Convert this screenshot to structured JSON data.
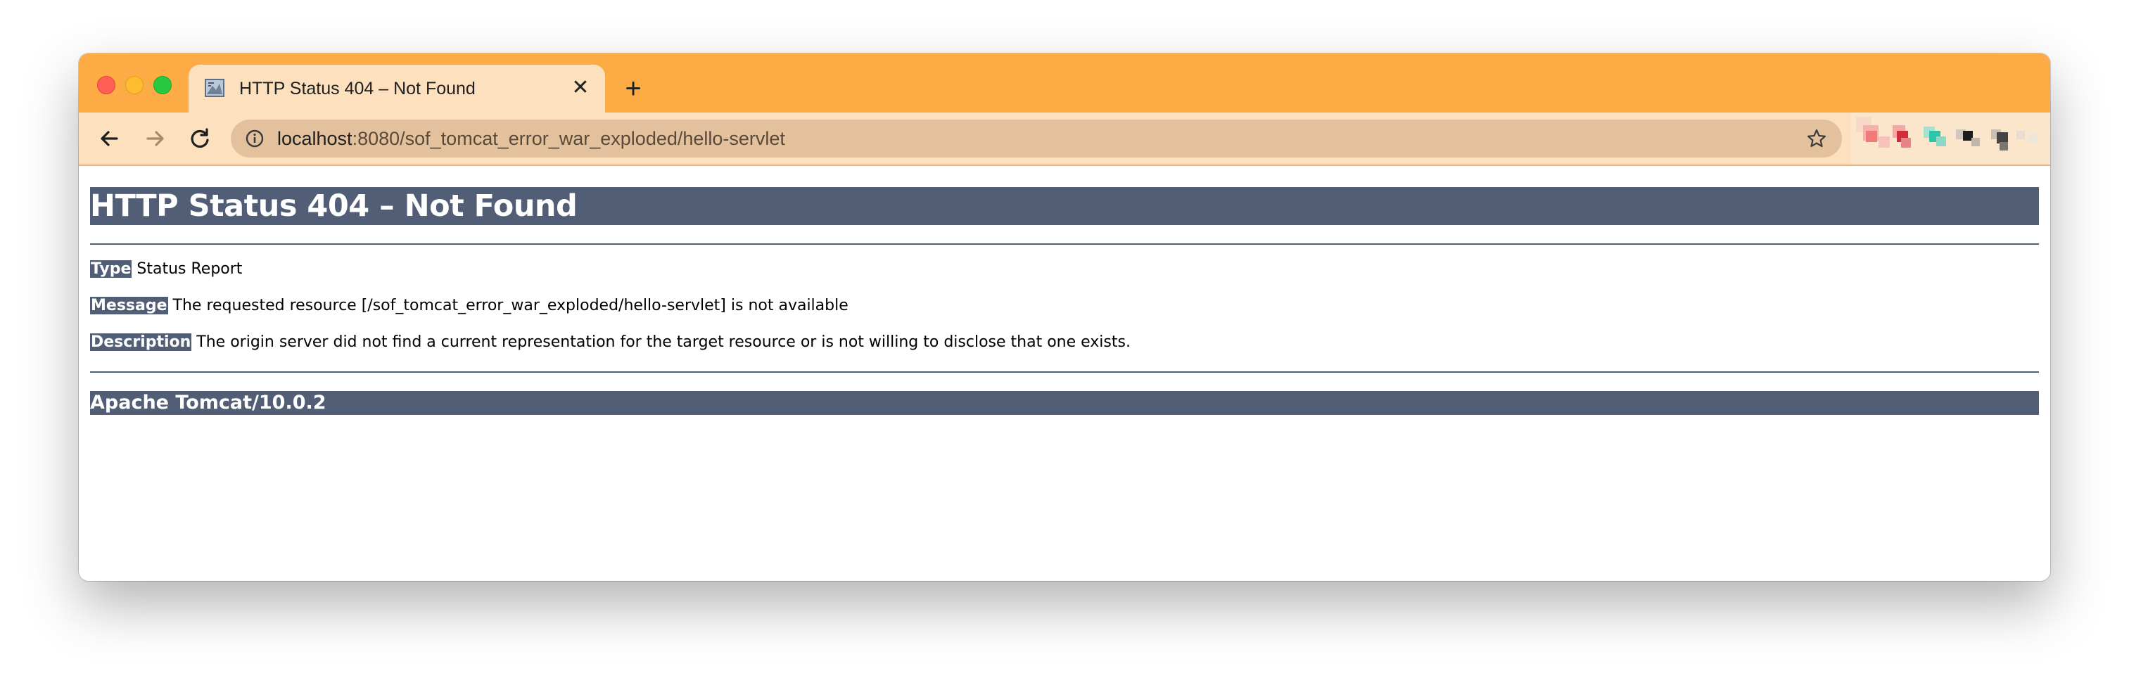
{
  "browser": {
    "tab": {
      "title": "HTTP Status 404 – Not Found",
      "close_glyph": "✕",
      "favicon": "tomcat-favicon"
    },
    "new_tab_glyph": "+",
    "omnibox": {
      "url_host": "localhost",
      "url_rest": ":8080/sof_tomcat_error_war_exploded/hello-servlet"
    },
    "icons": {
      "back": "arrow-left-icon",
      "forward": "arrow-right-icon",
      "reload": "reload-icon",
      "info": "info-icon",
      "bookmark": "star-icon"
    },
    "colors": {
      "tabstrip": "#fdab45",
      "toolbar": "#fde1bf",
      "omnibox": "#e3c19d"
    }
  },
  "page": {
    "title": "HTTP Status 404 – Not Found",
    "type_label": "Type",
    "type_value": "Status Report",
    "message_label": "Message",
    "message_value": "The requested resource [/sof_tomcat_error_war_exploded/hello-servlet] is not available",
    "description_label": "Description",
    "description_value": "The origin server did not find a current representation for the target resource or is not willing to disclose that one exists.",
    "footer": "Apache Tomcat/10.0.2",
    "colors": {
      "header_bg": "#525d76",
      "header_text": "#ffffff"
    }
  }
}
